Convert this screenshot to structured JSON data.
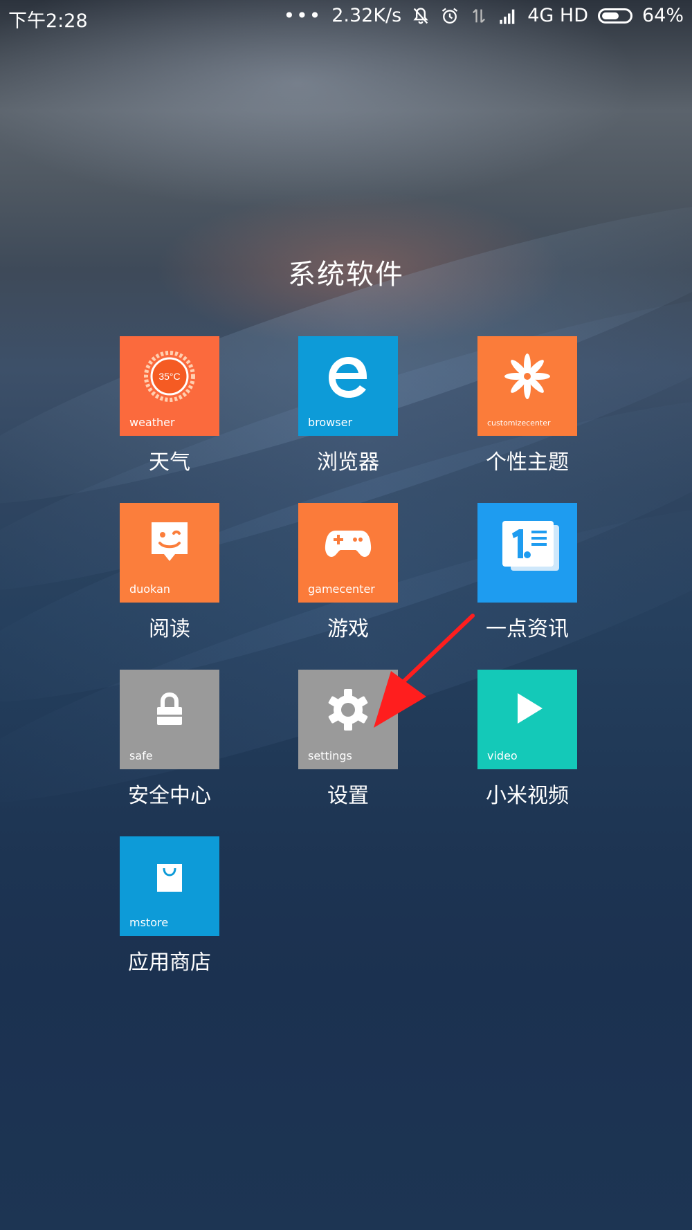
{
  "status_bar": {
    "time": "下午2:28",
    "dots": "•••",
    "network_speed": "2.32K/s",
    "network_type": "4G HD",
    "battery_percent": "64%",
    "battery_level": 0.64
  },
  "folder": {
    "title": "系统软件"
  },
  "apps": [
    {
      "label": "天气",
      "caption": "weather",
      "color": "#fb6a3d",
      "badge_text": "35°C"
    },
    {
      "label": "浏览器",
      "caption": "browser",
      "color": "#0d9bd8"
    },
    {
      "label": "个性主题",
      "caption": "customizecenter",
      "color": "#fb7c3a"
    },
    {
      "label": "阅读",
      "caption": "duokan",
      "color": "#fb7e3c"
    },
    {
      "label": "游戏",
      "caption": "gamecenter",
      "color": "#fb7b3a"
    },
    {
      "label": "一点资讯",
      "caption": "",
      "color": "#1e9cf0"
    },
    {
      "label": "安全中心",
      "caption": "safe",
      "color": "#9a9a9a"
    },
    {
      "label": "设置",
      "caption": "settings",
      "color": "#9a9a9a"
    },
    {
      "label": "小米视频",
      "caption": "video",
      "color": "#14c9b8"
    },
    {
      "label": "应用商店",
      "caption": "mstore",
      "color": "#0d9bd8"
    }
  ],
  "annotation": {
    "arrow_color": "#ff1e1e"
  }
}
